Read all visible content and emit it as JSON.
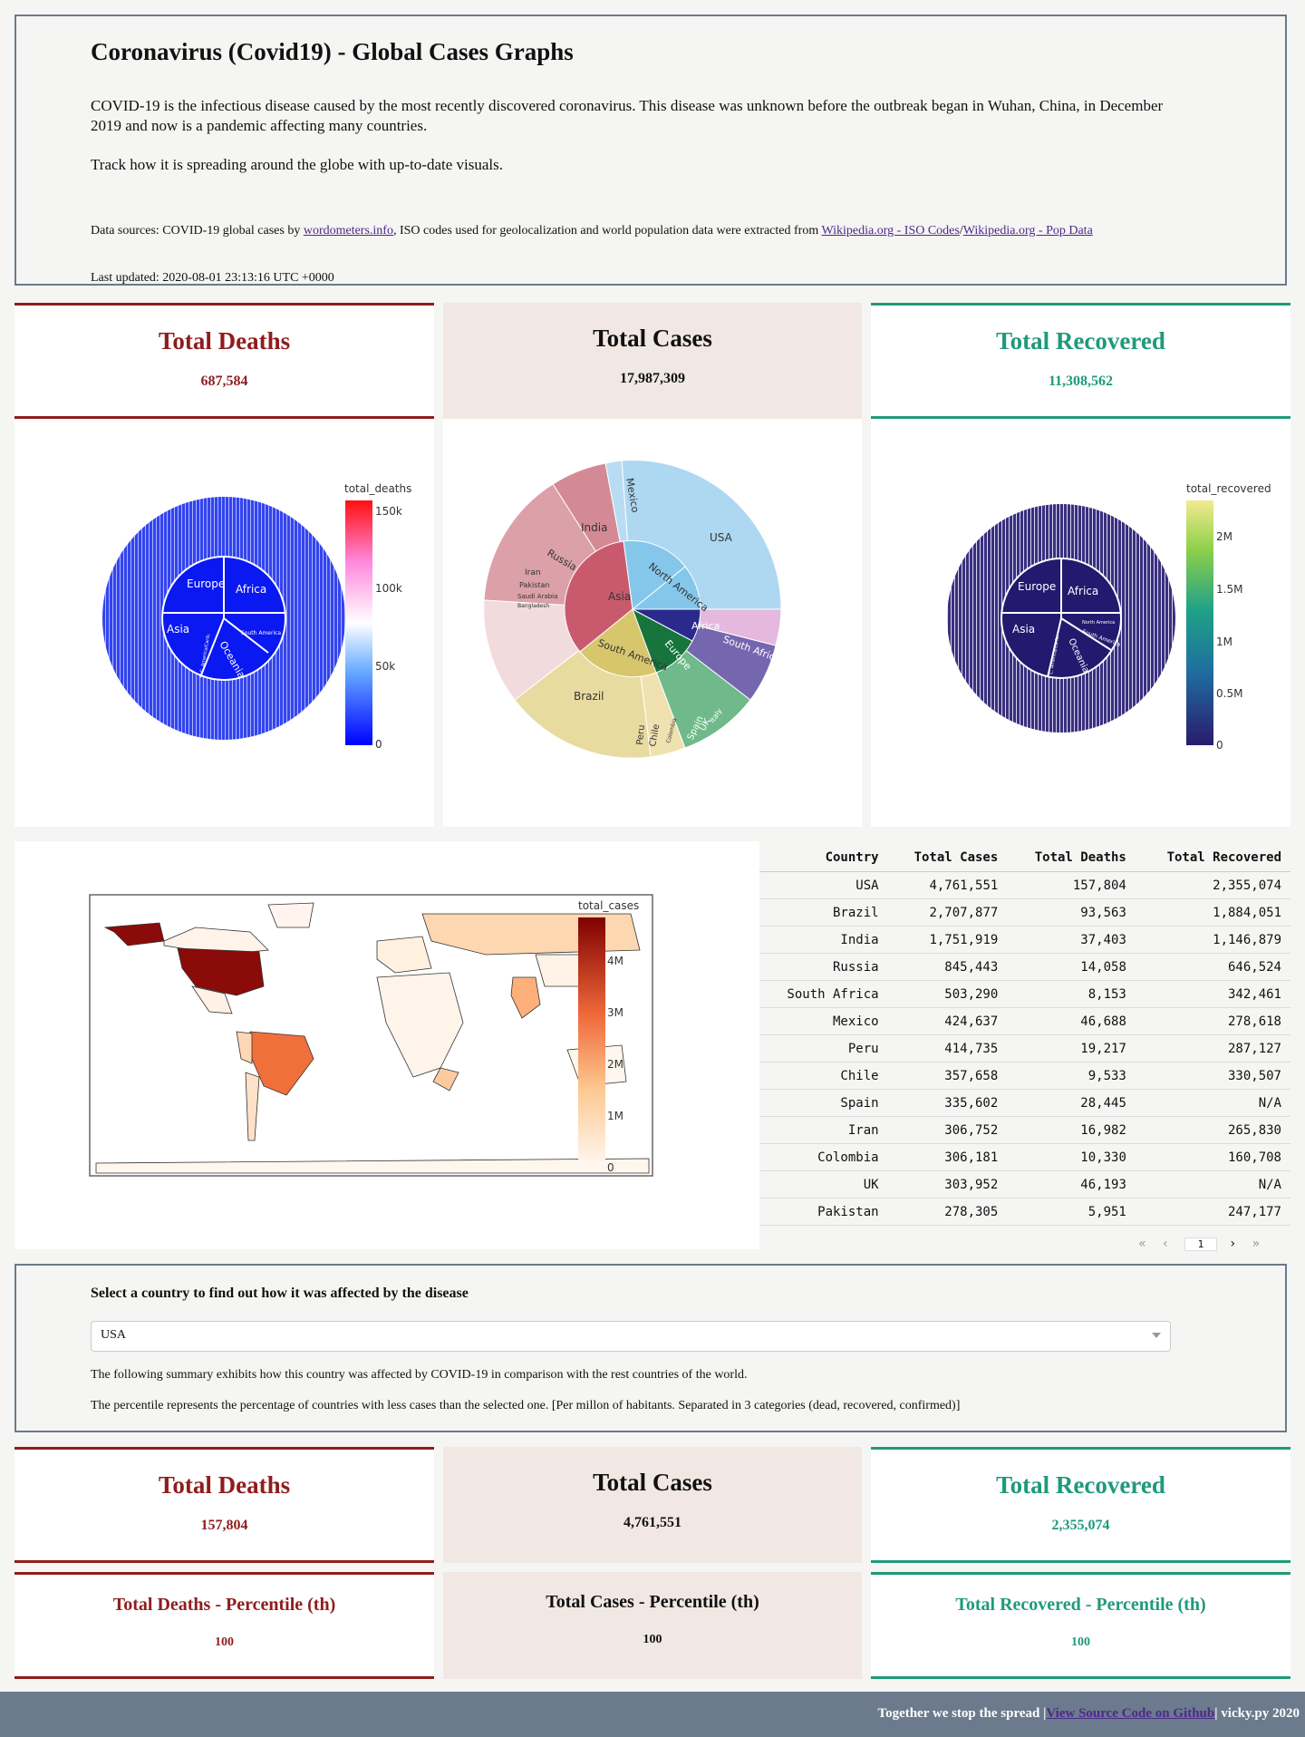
{
  "header": {
    "title": "Coronavirus (Covid19) - Global Cases Graphs",
    "intro": "COVID-19 is the infectious disease caused by the most recently discovered coronavirus. This disease was unknown before the outbreak began in Wuhan, China, in December 2019 and now is a pandemic affecting many countries.",
    "track": "Track how it is spreading around the globe with up-to-date visuals.",
    "sources_prefix": "Data sources: COVID-19 global cases by ",
    "link_worldometers": "wordometers.info",
    "sources_mid": ", ISO codes used for geolocalization and world population data were extracted from ",
    "link_iso": "Wikipedia.org - ISO Codes",
    "link_pop": "Wikipedia.org - Pop Data",
    "updated": "Last updated: 2020-08-01 23:13:16 UTC +0000"
  },
  "global": {
    "deaths_label": "Total Deaths",
    "deaths_value": "687,584",
    "cases_label": "Total Cases",
    "cases_value": "17,987,309",
    "recovered_label": "Total Recovered",
    "recovered_value": "11,308,562"
  },
  "colors": {
    "deaths": "#8f1d1d",
    "recovered": "#1f9a7a",
    "cases_bg": "#f1e8e3",
    "frame": "#6b7a8c"
  },
  "sunburst_deaths": {
    "colorbar_title": "total_deaths",
    "ticks": [
      "150k",
      "100k",
      "50k",
      "0"
    ],
    "labels": [
      "Europe",
      "Africa",
      "Asia",
      "South America",
      "C. America/Carib.",
      "Oceania"
    ]
  },
  "sunburst_cases": {
    "labels": [
      "USA",
      "Mexico",
      "India",
      "Russia",
      "Iran",
      "Pakistan",
      "Saudi Arabia",
      "Bangladesh",
      "Asia",
      "North America",
      "Africa",
      "South Africa",
      "Europe",
      "South America",
      "Brazil",
      "Peru",
      "Chile",
      "Colombia",
      "Spain",
      "UK",
      "Italy"
    ]
  },
  "sunburst_recovered": {
    "colorbar_title": "total_recovered",
    "ticks": [
      "2M",
      "1.5M",
      "1M",
      "0.5M",
      "0"
    ],
    "labels": [
      "Europe",
      "Africa",
      "Asia",
      "North America",
      "South America",
      "Oceania",
      "C. America/Carib."
    ]
  },
  "map": {
    "colorbar_title": "total_cases",
    "ticks": [
      "4M",
      "3M",
      "2M",
      "1M",
      "0"
    ]
  },
  "table": {
    "columns": [
      "Country",
      "Total Cases",
      "Total Deaths",
      "Total Recovered"
    ],
    "rows": [
      [
        "USA",
        "4,761,551",
        "157,804",
        "2,355,074"
      ],
      [
        "Brazil",
        "2,707,877",
        "93,563",
        "1,884,051"
      ],
      [
        "India",
        "1,751,919",
        "37,403",
        "1,146,879"
      ],
      [
        "Russia",
        "845,443",
        "14,058",
        "646,524"
      ],
      [
        "South Africa",
        "503,290",
        "8,153",
        "342,461"
      ],
      [
        "Mexico",
        "424,637",
        "46,688",
        "278,618"
      ],
      [
        "Peru",
        "414,735",
        "19,217",
        "287,127"
      ],
      [
        "Chile",
        "357,658",
        "9,533",
        "330,507"
      ],
      [
        "Spain",
        "335,602",
        "28,445",
        "N/A"
      ],
      [
        "Iran",
        "306,752",
        "16,982",
        "265,830"
      ],
      [
        "Colombia",
        "306,181",
        "10,330",
        "160,708"
      ],
      [
        "UK",
        "303,952",
        "46,193",
        "N/A"
      ],
      [
        "Pakistan",
        "278,305",
        "5,951",
        "247,177"
      ]
    ],
    "page": "1",
    "first": "«",
    "prev": "‹",
    "next": "›",
    "last": "»"
  },
  "selector": {
    "heading": "Select a country to find out how it was affected by the disease",
    "selected": "USA",
    "note1": "The following summary exhibits how this country was affected by COVID-19 in comparison with the rest countries of the world.",
    "note2": "The percentile represents the percentage of countries with less cases than the selected one. [Per millon of habitants. Separated in 3 categories (dead, recovered, confirmed)]"
  },
  "country": {
    "deaths_label": "Total Deaths",
    "deaths_value": "157,804",
    "cases_label": "Total Cases",
    "cases_value": "4,761,551",
    "recovered_label": "Total Recovered",
    "recovered_value": "2,355,074",
    "deaths_pct_label": "Total Deaths - Percentile (th)",
    "deaths_pct": "100",
    "cases_pct_label": "Total Cases - Percentile (th)",
    "cases_pct": "100",
    "recovered_pct_label": "Total Recovered - Percentile (th)",
    "recovered_pct": "100"
  },
  "footer": {
    "prefix": "Together we stop the spread |",
    "link": "View Source Code on Github",
    "suffix": "| vicky.py 2020"
  }
}
